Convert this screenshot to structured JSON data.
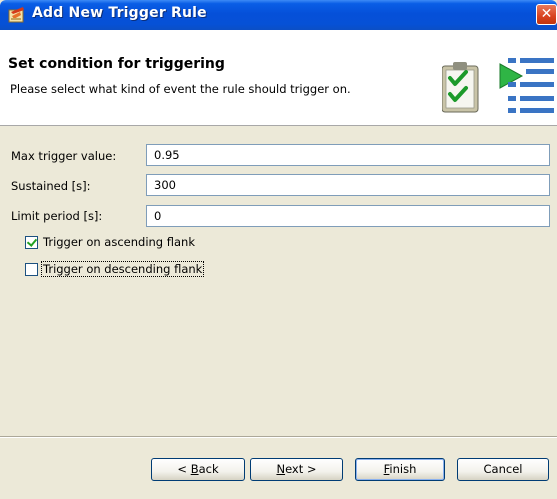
{
  "window": {
    "title": "Add New Trigger Rule",
    "close_glyph": "✕"
  },
  "header": {
    "title": "Set condition for triggering",
    "description": "Please select what kind of event the rule should trigger on."
  },
  "form": {
    "max_trigger": {
      "label": "Max trigger value:",
      "value": "0.95"
    },
    "sustained": {
      "label": "Sustained [s]:",
      "value": "300"
    },
    "limit_period": {
      "label": "Limit period [s]:",
      "value": "0"
    },
    "ascending": {
      "label": "Trigger on ascending flank",
      "checked": true
    },
    "descending": {
      "label": "Trigger on descending flank",
      "checked": false
    }
  },
  "buttons": {
    "back": {
      "prefix": "< ",
      "mnemonic": "B",
      "rest": "ack"
    },
    "next": {
      "mnemonic": "N",
      "rest": "ext >"
    },
    "finish": {
      "mnemonic": "F",
      "rest": "inish"
    },
    "cancel": {
      "label": "Cancel"
    }
  },
  "icons": {
    "app": "trigger-rule-icon",
    "wizard": "checklist-wizard-icon",
    "close": "close-icon"
  },
  "colors": {
    "titlebar": "#0550d9",
    "window_bg": "#ece9d8",
    "check_mark": "#21a121"
  }
}
